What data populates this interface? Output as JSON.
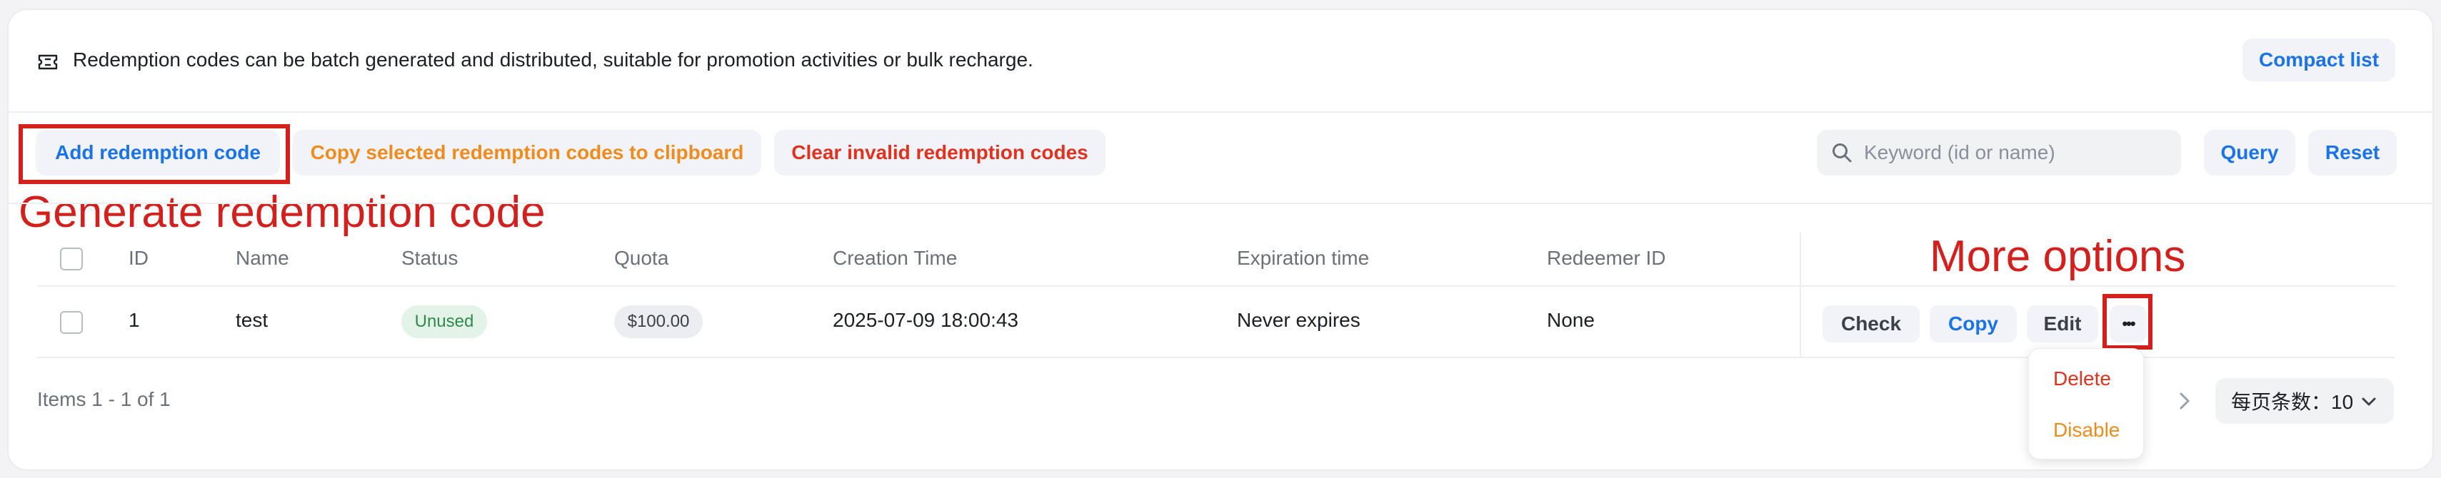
{
  "notice": {
    "text": "Redemption codes can be batch generated and distributed, suitable for promotion activities or bulk recharge.",
    "icon": "ticket-icon"
  },
  "toolbar": {
    "compact_list_label": "Compact list",
    "add_label": "Add redemption code",
    "copy_selected_label": "Copy selected redemption codes to clipboard",
    "clear_invalid_label": "Clear invalid redemption codes",
    "search_placeholder": "Keyword (id or name)",
    "query_label": "Query",
    "reset_label": "Reset"
  },
  "annotations": {
    "generate": "Generate redemption code",
    "more_options": "More options"
  },
  "table": {
    "headers": {
      "id": "ID",
      "name": "Name",
      "status": "Status",
      "quota": "Quota",
      "creation_time": "Creation Time",
      "expiration_time": "Expiration time",
      "redeemer_id": "Redeemer ID"
    },
    "rows": [
      {
        "id": "1",
        "name": "test",
        "status": "Unused",
        "quota": "$100.00",
        "creation_time": "2025-07-09 18:00:43",
        "expiration_time": "Never expires",
        "redeemer_id": "None",
        "actions": {
          "check": "Check",
          "copy": "Copy",
          "edit": "Edit",
          "more": "•••"
        }
      }
    ]
  },
  "more_menu": {
    "delete": "Delete",
    "disable": "Disable"
  },
  "footer": {
    "items_text": "Items 1 - 1 of 1",
    "page_size_text": "每页条数：10"
  },
  "colors": {
    "accent_blue": "#1a73e8",
    "warning_orange": "#f08c1d",
    "danger_red": "#e0321f",
    "annotation_red": "#d3201d",
    "status_green_bg": "#e3f3e8",
    "status_green_text": "#2f8a4c"
  }
}
